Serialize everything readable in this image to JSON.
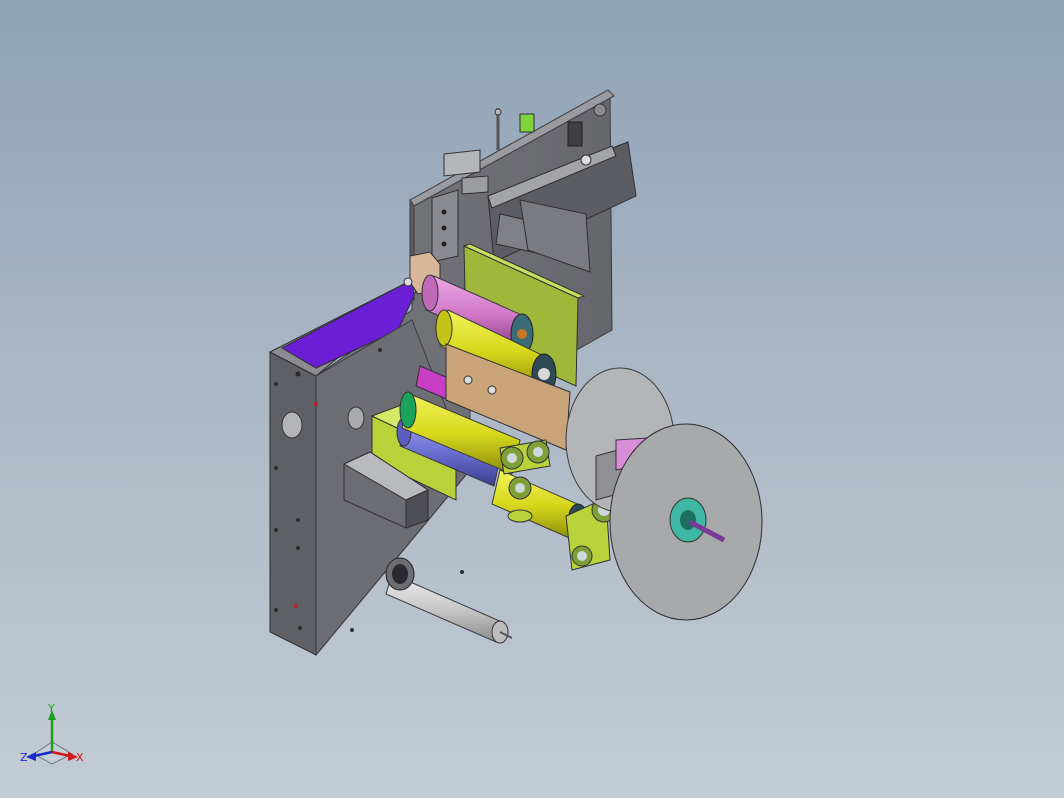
{
  "viewport": {
    "background_top": "#8fa2b6",
    "background_bottom": "#c4ccd5"
  },
  "triad": {
    "x_label": "X",
    "y_label": "Y",
    "z_label": "Z",
    "x_color": "#d01818",
    "y_color": "#1aa01a",
    "z_color": "#1a2ad0"
  },
  "colors": {
    "plate": "#6e6f74",
    "plate_edge": "#8a8b90",
    "purple": "#6a1fd6",
    "roller_yellow": "#d7d81c",
    "roller_pink": "#d27ac9",
    "roller_blue": "#6b6fd0",
    "bracket_green": "#b9d23a",
    "bracket_magenta": "#c83fc6",
    "reel": "#a8a9ab",
    "shaft": "#c9c9c9"
  }
}
